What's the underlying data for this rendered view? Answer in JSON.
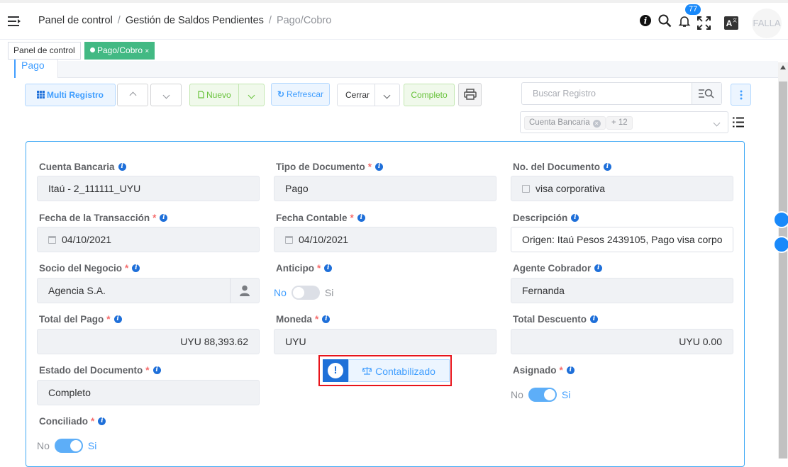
{
  "header": {
    "breadcrumb": [
      "Panel de control",
      "Gestión de Saldos Pendientes",
      "Pago/Cobro"
    ],
    "notification_count": "77",
    "avatar_text": "FALLA"
  },
  "tags": [
    {
      "label": "Panel de control"
    },
    {
      "label": "Pago/Cobro",
      "close": "×"
    }
  ],
  "tab": {
    "label": "Pago"
  },
  "toolbar": {
    "multi_registro": "Multi Registro",
    "nuevo": "Nuevo",
    "refrescar": "Refrescar",
    "cerrar": "Cerrar",
    "completo": "Completo"
  },
  "search": {
    "placeholder": "Buscar Registro"
  },
  "filter": {
    "chip": "Cuenta Bancaria",
    "more": "+ 12"
  },
  "fields": {
    "cuenta_bancaria": {
      "label": "Cuenta Bancaria",
      "value": "Itaú - 2_111111_UYU"
    },
    "tipo_documento": {
      "label": "Tipo de Documento",
      "value": "Pago"
    },
    "no_documento": {
      "label": "No. del Documento",
      "value": "visa corporativa"
    },
    "fecha_transaccion": {
      "label": "Fecha de la Transacción",
      "value": "04/10/2021"
    },
    "fecha_contable": {
      "label": "Fecha Contable",
      "value": "04/10/2021"
    },
    "descripcion": {
      "label": "Descripción",
      "value": "Origen: Itaú Pesos 2439105, Pago visa corpo"
    },
    "socio_negocio": {
      "label": "Socio del Negocio",
      "value": "Agencia S.A."
    },
    "anticipo": {
      "label": "Anticipo",
      "off": "No",
      "on": "Si",
      "state": false
    },
    "agente_cobrador": {
      "label": "Agente Cobrador",
      "value": "Fernanda"
    },
    "total_pago": {
      "label": "Total del Pago",
      "value": "UYU 88,393.62"
    },
    "moneda": {
      "label": "Moneda",
      "value": "UYU"
    },
    "total_descuento": {
      "label": "Total Descuento",
      "value": "UYU 0.00"
    },
    "estado_documento": {
      "label": "Estado del Documento",
      "value": "Completo"
    },
    "asignado": {
      "label": "Asignado",
      "off": "No",
      "on": "Si",
      "state": true
    },
    "conciliado": {
      "label": "Conciliado",
      "off": "No",
      "on": "Si",
      "state": true
    }
  },
  "status_button": {
    "label": "Contabilizado",
    "icon": "!"
  },
  "colors": {
    "accent": "#409eff",
    "active_tag": "#42b983",
    "required": "#f56c6c",
    "highlight_border": "#e8141b"
  }
}
